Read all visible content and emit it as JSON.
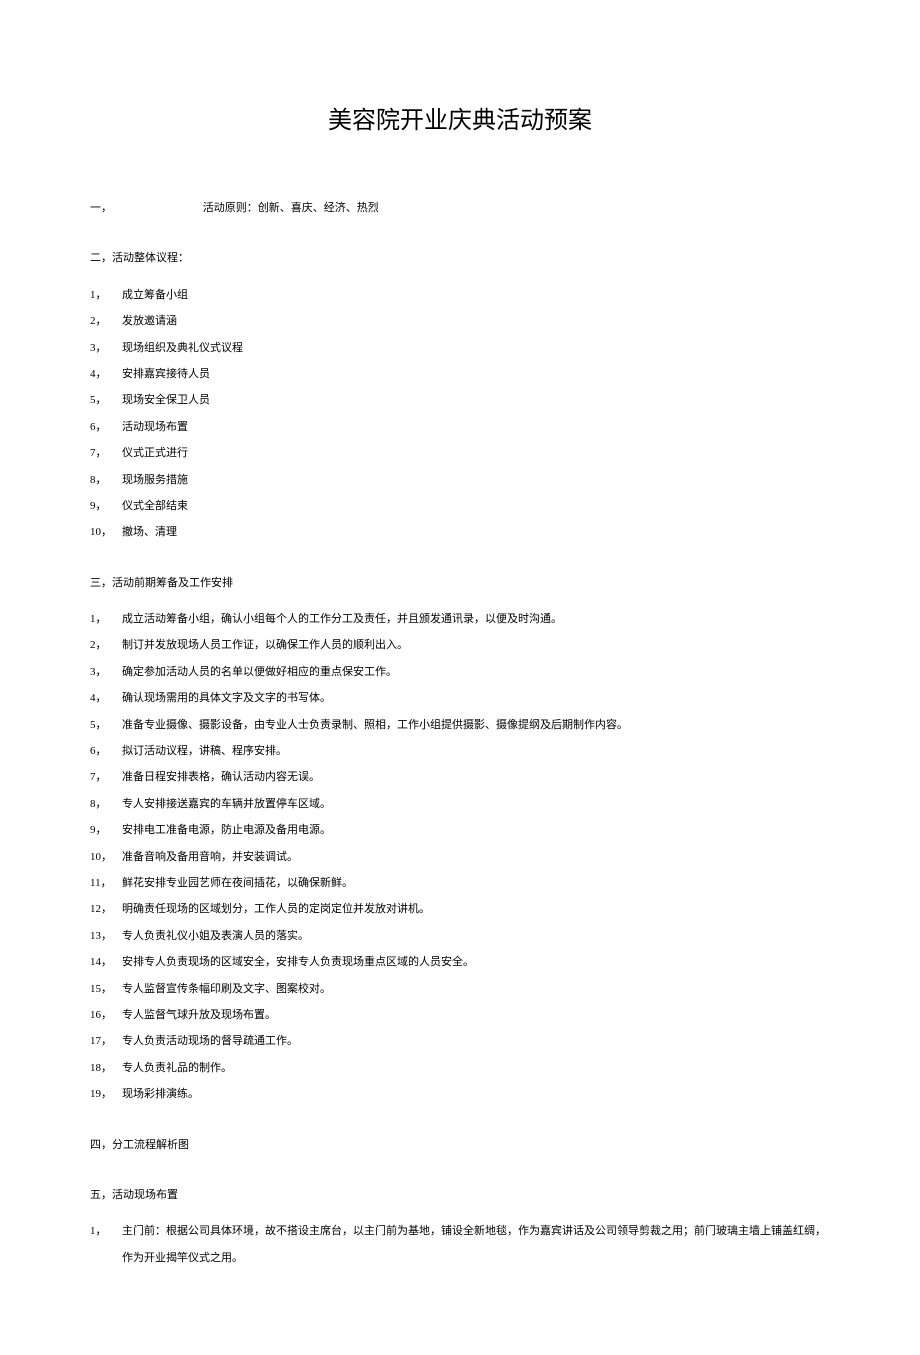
{
  "title": "美容院开业庆典活动预案",
  "section1": {
    "label": "一，",
    "content": "活动原则：创新、喜庆、经济、热烈"
  },
  "section2": {
    "heading": "二，活动整体议程：",
    "items": [
      {
        "num": "1，",
        "text": "成立筹备小组"
      },
      {
        "num": "2，",
        "text": "发放邀请涵"
      },
      {
        "num": "3，",
        "text": "现场组织及典礼仪式议程"
      },
      {
        "num": "4，",
        "text": "安排嘉宾接待人员"
      },
      {
        "num": "5，",
        "text": "现场安全保卫人员"
      },
      {
        "num": "6，",
        "text": "活动现场布置"
      },
      {
        "num": "7，",
        "text": "仪式正式进行"
      },
      {
        "num": "8，",
        "text": "现场服务措施"
      },
      {
        "num": "9，",
        "text": "仪式全部结束"
      },
      {
        "num": "10，",
        "text": "撤场、清理"
      }
    ]
  },
  "section3": {
    "heading": "三，活动前期筹备及工作安排",
    "items": [
      {
        "num": "1，",
        "text": "成立活动筹备小组，确认小组每个人的工作分工及责任，并且颁发通讯录，以便及时沟通。"
      },
      {
        "num": "2，",
        "text": "制订并发放现场人员工作证，以确保工作人员的顺利出入。"
      },
      {
        "num": "3，",
        "text": "确定参加活动人员的名单以便做好相应的重点保安工作。"
      },
      {
        "num": "4，",
        "text": "确认现场需用的具体文字及文字的书写体。"
      },
      {
        "num": "5，",
        "text": "准备专业摄像、摄影设备，由专业人士负责录制、照相，工作小组提供摄影、摄像提纲及后期制作内容。"
      },
      {
        "num": "6，",
        "text": "拟订活动议程，讲稿、程序安排。"
      },
      {
        "num": "7，",
        "text": "准备日程安排表格，确认活动内容无误。"
      },
      {
        "num": "8，",
        "text": "专人安排接送嘉宾的车辆并放置停车区域。"
      },
      {
        "num": "9，",
        "text": "安排电工准备电源，防止电源及备用电源。"
      },
      {
        "num": "10，",
        "text": "准备音响及备用音响，并安装调试。"
      },
      {
        "num": "11，",
        "text": "鲜花安排专业园艺师在夜间插花，以确保新鲜。"
      },
      {
        "num": "12，",
        "text": "明确责任现场的区域划分，工作人员的定岗定位并发放对讲机。"
      },
      {
        "num": "13，",
        "text": "专人负责礼仪小姐及表演人员的落实。"
      },
      {
        "num": "14，",
        "text": "安排专人负责现场的区域安全，安排专人负责现场重点区域的人员安全。"
      },
      {
        "num": "15，",
        "text": "专人监督宣传条幅印刷及文字、图案校对。"
      },
      {
        "num": "16，",
        "text": "专人监督气球升放及现场布置。"
      },
      {
        "num": "17，",
        "text": "专人负责活动现场的督导疏通工作。"
      },
      {
        "num": "18，",
        "text": "专人负责礼品的制作。"
      },
      {
        "num": "19，",
        "text": "现场彩排演练。"
      }
    ]
  },
  "section4": {
    "heading": "四，分工流程解析图"
  },
  "section5": {
    "heading": "五，活动现场布置",
    "items": [
      {
        "num": "1，",
        "text": "主门前：根据公司具体环境，故不搭设主席台，以主门前为基地，铺设全新地毯，作为嘉宾讲话及公司领导剪裁之用；前门玻璃主墙上铺盖红绸，作为开业揭竿仪式之用。"
      }
    ]
  }
}
